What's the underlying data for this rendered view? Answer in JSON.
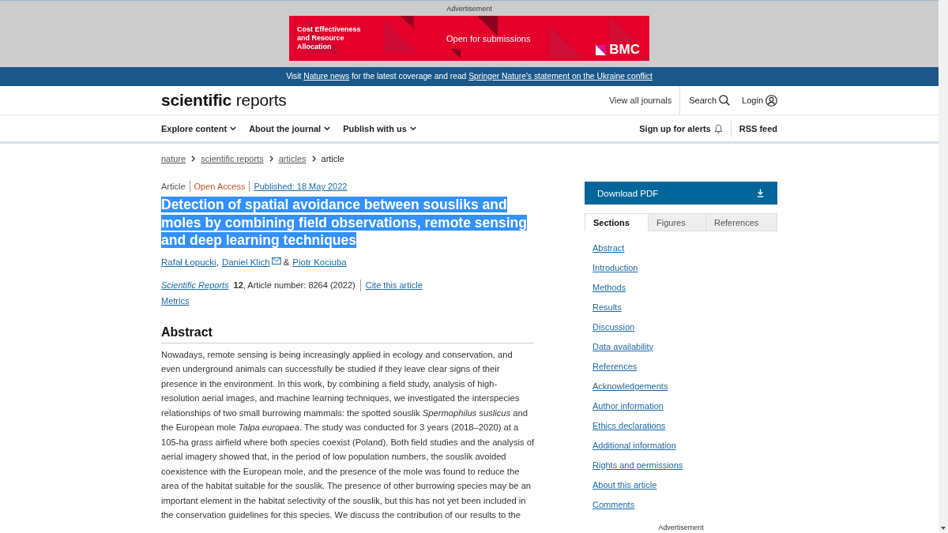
{
  "advert": {
    "label": "Advertisement",
    "banner": {
      "title": "Cost Effectiveness and Resource Allocation",
      "tagline": "Open for submissions",
      "logo": "BMC"
    }
  },
  "notice": [
    {
      "kind": "text",
      "text": "Visit "
    },
    {
      "kind": "link",
      "text": "Nature news"
    },
    {
      "kind": "text",
      "text": " for the latest coverage and read "
    },
    {
      "kind": "link",
      "text": "Springer Nature's statement on the Ukraine conflict"
    }
  ],
  "header": {
    "logo": "**scientific** reports",
    "journals_link": "View all journals",
    "search": "Search",
    "login": "Login"
  },
  "nav": {
    "menus": [
      {
        "label": "Explore content",
        "expanded": false
      },
      {
        "label": "About the journal",
        "expanded": false
      },
      {
        "label": "Publish with us",
        "expanded": false
      }
    ],
    "alerts": "Sign up for alerts",
    "rss": "RSS feed"
  },
  "breadcrumb": [
    {
      "label": "nature",
      "current": false
    },
    {
      "label": "scientific reports",
      "current": false
    },
    {
      "label": "articles",
      "current": false
    },
    {
      "label": "article",
      "current": true
    }
  ],
  "article": {
    "type": "Article",
    "access": "Open Access",
    "published": "Published: 18 May 2022",
    "title": {
      "text": "Detection of spatial avoidance between sousliks and moles by combining field observations, remote sensing and deep learning techniques",
      "highlighted": true
    },
    "authors": [
      {
        "name": "Rafał Łopucki",
        "corresponding": false,
        "separator": ","
      },
      {
        "name": "Daniel Klich",
        "corresponding": true,
        "separator": "&"
      },
      {
        "name": "Piotr Kociuba",
        "corresponding": false
      }
    ],
    "citation": {
      "journal": "Scientific Reports",
      "details": "**12**, Article number: 8264 (2022)",
      "cite": "Cite this article"
    },
    "metrics": "Metrics"
  },
  "abstract": {
    "heading": "Abstract",
    "text": "Nowadays, remote sensing is being increasingly applied in ecology and conservation, and even underground animals can successfully be studied if they leave clear signs of their presence in the environment. In this work, by combining a field study, analysis of high-resolution aerial images, and machine learning techniques, we investigated the interspecies relationships of two small burrowing mammals: the spotted souslik *Spermophilus suslicus* and the European mole *Talpa europaea*. The study was conducted for 3 years (2018–2020) at a 105-ha grass airfield where both species coexist (Poland). Both field studies and the analysis of aerial imagery showed that, in the period of low population numbers, the souslik avoided coexistence with the European mole, and the presence of the mole was found to reduce the area of the habitat suitable for the souslik. The presence of other burrowing species may be an important element in the habitat selectivity of the souslik, but this has not yet been included in the conservation guidelines for this species. We discuss the contribution of our results to the"
  },
  "sidebar": {
    "download": "Download PDF",
    "tabs": [
      {
        "label": "Sections",
        "selected": true
      },
      {
        "label": "Figures",
        "selected": false
      },
      {
        "label": "References",
        "selected": false
      }
    ],
    "sections": [
      "Abstract",
      "Introduction",
      "Methods",
      "Results",
      "Discussion",
      "Data availability",
      "References",
      "Acknowledgements",
      "Author information",
      "Ethics declarations",
      "Additional information",
      "Rights and permissions",
      "About this article",
      "Comments"
    ],
    "advert_label": "Advertisement"
  }
}
